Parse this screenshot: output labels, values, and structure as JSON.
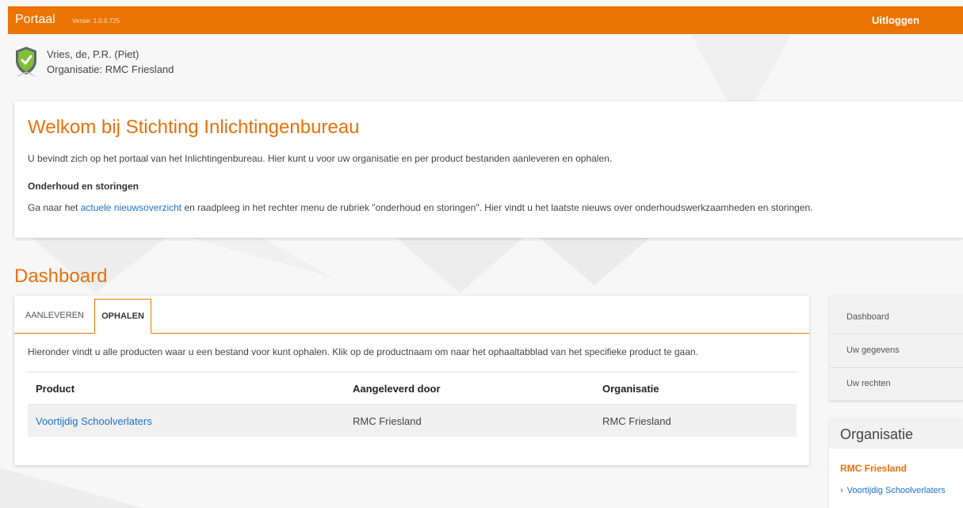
{
  "header": {
    "title": "Portaal",
    "version": "Versie: 1.0.0.725",
    "logout_label": "Uitloggen"
  },
  "user": {
    "name": "Vries, de, P.R. (Piet)",
    "organisation": "Organisatie: RMC Friesland"
  },
  "welcome": {
    "title": "Welkom bij Stichting Inlichtingenbureau",
    "intro": "U bevindt zich op het portaal van het Inlichtingenbureau. Hier kunt u voor uw organisatie en per product bestanden aanleveren en ophalen.",
    "maintenance_heading": "Onderhoud en storingen",
    "news_prefix": "Ga naar het ",
    "news_link": "actuele nieuwsoverzicht",
    "news_suffix": " en raadpleeg in het rechter menu de rubriek \"onderhoud en storingen\". Hier vindt u het laatste nieuws over onderhoudswerkzaamheden en storingen."
  },
  "dashboard": {
    "title": "Dashboard",
    "tabs": [
      {
        "label": "AANLEVEREN",
        "active": false
      },
      {
        "label": "OPHALEN",
        "active": true
      }
    ],
    "description": "Hieronder vindt u alle producten waar u een bestand voor kunt ophalen. Klik op de productnaam om naar het ophaaltabblad van het specifieke product te gaan.",
    "columns": [
      "Product",
      "Aangeleverd door",
      "Organisatie"
    ],
    "rows": [
      {
        "product": "Voortijdig Schoolverlaters",
        "delivered_by": "RMC Friesland",
        "organisation": "RMC Friesland"
      }
    ]
  },
  "sidebar": {
    "items": [
      {
        "label": "Dashboard"
      },
      {
        "label": "Uw gegevens"
      },
      {
        "label": "Uw rechten"
      }
    ],
    "org_heading": "Organisatie",
    "org_name": "RMC Friesland",
    "org_product": "Voortijdig Schoolverlaters"
  },
  "colors": {
    "accent": "#ec7404",
    "link": "#1f71c8"
  },
  "icons": {
    "logo": "shield-check-icon",
    "sidebar_link": "chevron-right-icon"
  }
}
